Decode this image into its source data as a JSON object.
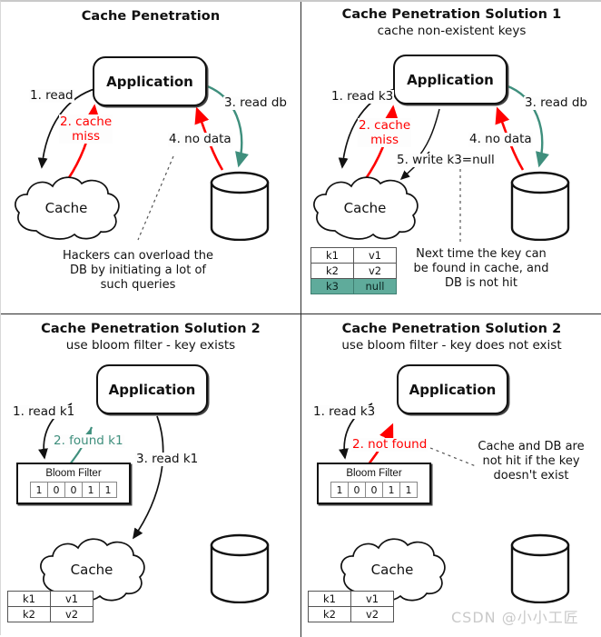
{
  "panels": [
    {
      "id": "cache-penetration",
      "title": "Cache Penetration",
      "subtitle": "",
      "app_label": "Application",
      "cache_label": "Cache",
      "steps": [
        {
          "id": "step-1",
          "text": "1. read",
          "color": "#111111"
        },
        {
          "id": "step-2",
          "text": "2. cache\nmiss",
          "color": "#ff0000"
        },
        {
          "id": "step-3",
          "text": "3. read db",
          "color": "#111111"
        },
        {
          "id": "step-4",
          "text": "4. no data",
          "color": "#111111"
        }
      ],
      "note": "Hackers can overload the\nDB by initiating a lot of\nsuch queries"
    },
    {
      "id": "solution-1",
      "title": "Cache Penetration Solution 1",
      "subtitle": "cache non-existent keys",
      "app_label": "Application",
      "cache_label": "Cache",
      "steps": [
        {
          "id": "step-1",
          "text": "1. read k3",
          "color": "#111111"
        },
        {
          "id": "step-2",
          "text": "2. cache\nmiss",
          "color": "#ff0000"
        },
        {
          "id": "step-3",
          "text": "3. read db",
          "color": "#111111"
        },
        {
          "id": "step-4",
          "text": "4. no data",
          "color": "#111111"
        },
        {
          "id": "step-5",
          "text": "5. write k3=null",
          "color": "#111111"
        }
      ],
      "note": "Next time the key can\nbe found in cache, and\nDB is not hit",
      "table": {
        "rows": [
          {
            "key": "k1",
            "value": "v1",
            "highlight": false
          },
          {
            "key": "k2",
            "value": "v2",
            "highlight": false
          },
          {
            "key": "k3",
            "value": "null",
            "highlight": true
          }
        ],
        "highlight_color": "#5fab9b"
      }
    },
    {
      "id": "solution-2-key-exists",
      "title": "Cache Penetration Solution 2",
      "subtitle": "use bloom filter - key exists",
      "app_label": "Application",
      "cache_label": "Cache",
      "steps": [
        {
          "id": "step-1",
          "text": "1. read k1",
          "color": "#111111"
        },
        {
          "id": "step-2",
          "text": "2. found k1",
          "color": "#3f8f7d"
        },
        {
          "id": "step-3",
          "text": "3. read k1",
          "color": "#111111"
        }
      ],
      "note": "",
      "bloom_filter": {
        "label": "Bloom Filter",
        "bits": [
          "1",
          "0",
          "0",
          "1",
          "1"
        ]
      },
      "table": {
        "rows": [
          {
            "key": "k1",
            "value": "v1",
            "highlight": false
          },
          {
            "key": "k2",
            "value": "v2",
            "highlight": false
          }
        ]
      }
    },
    {
      "id": "solution-2-key-missing",
      "title": "Cache Penetration Solution 2",
      "subtitle": "use bloom filter - key does not exist",
      "app_label": "Application",
      "cache_label": "Cache",
      "steps": [
        {
          "id": "step-1",
          "text": "1. read k3",
          "color": "#111111"
        },
        {
          "id": "step-2",
          "text": "2. not found",
          "color": "#ff0000"
        }
      ],
      "note": "Cache and DB are\nnot hit if the key\ndoesn't exist",
      "bloom_filter": {
        "label": "Bloom Filter",
        "bits": [
          "1",
          "0",
          "0",
          "1",
          "1"
        ]
      },
      "table": {
        "rows": [
          {
            "key": "k1",
            "value": "v1",
            "highlight": false
          },
          {
            "key": "k2",
            "value": "v2",
            "highlight": false
          }
        ]
      }
    }
  ],
  "watermark": "CSDN @小小工匠",
  "colors": {
    "red": "#ff0000",
    "teal": "#3f8f7d",
    "ink": "#111111",
    "table_highlight": "#5fab9b"
  }
}
